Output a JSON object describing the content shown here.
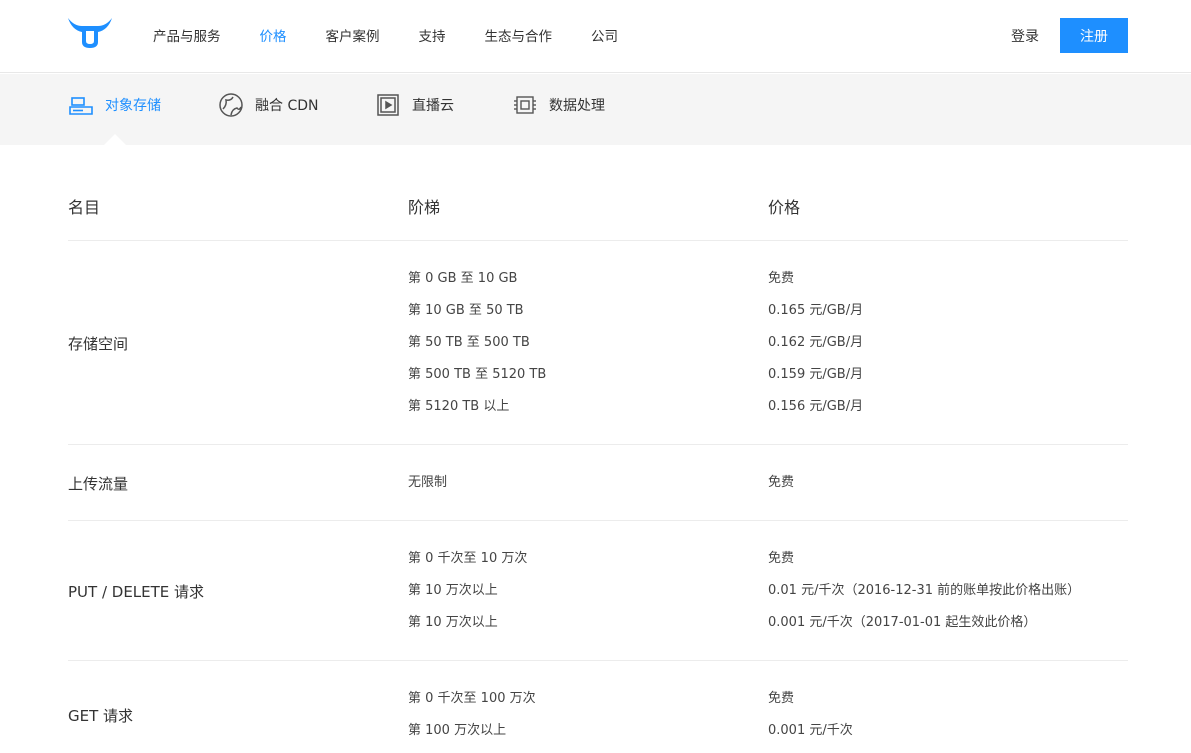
{
  "header": {
    "nav": [
      "产品与服务",
      "价格",
      "客户案例",
      "支持",
      "生态与合作",
      "公司"
    ],
    "active_nav": "价格",
    "login_label": "登录",
    "register_label": "注册",
    "brand_color": "#1e8fff"
  },
  "subnav": {
    "items": [
      {
        "label": "对象存储",
        "icon": "storage-icon"
      },
      {
        "label": "融合 CDN",
        "icon": "globe-icon"
      },
      {
        "label": "直播云",
        "icon": "live-video-icon"
      },
      {
        "label": "数据处理",
        "icon": "chip-icon"
      }
    ],
    "active": "对象存储"
  },
  "table": {
    "headers": [
      "名目",
      "阶梯",
      "价格"
    ],
    "rows": [
      {
        "name": "存储空间",
        "tiers": [
          "第 0 GB 至 10 GB",
          "第 10 GB 至 50 TB",
          "第 50 TB 至 500 TB",
          "第 500 TB 至 5120 TB",
          "第 5120 TB 以上"
        ],
        "prices": [
          "免费",
          "0.165 元/GB/月",
          "0.162 元/GB/月",
          "0.159 元/GB/月",
          "0.156 元/GB/月"
        ]
      },
      {
        "name": "上传流量",
        "tiers": [
          "无限制"
        ],
        "prices": [
          "免费"
        ]
      },
      {
        "name": "PUT / DELETE 请求",
        "tiers": [
          "第 0 千次至 10 万次",
          "第 10 万次以上",
          "第 10 万次以上"
        ],
        "prices": [
          "免费",
          "0.01 元/千次（2016-12-31 前的账单按此价格出账）",
          "0.001 元/千次（2017-01-01 起生效此价格）"
        ]
      },
      {
        "name": "GET 请求",
        "tiers": [
          "第 0 千次至 100 万次",
          "第 100 万次以上"
        ],
        "prices": [
          "免费",
          "0.001 元/千次"
        ]
      }
    ]
  }
}
